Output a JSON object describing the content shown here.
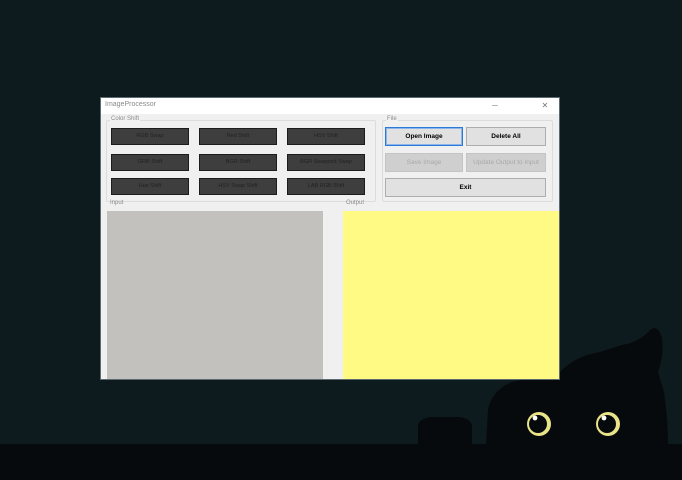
{
  "window": {
    "title": "ImageProcessor"
  },
  "controls": {
    "color_shift_label": "Color Shift",
    "buttons": [
      [
        "RGB Swap",
        "Red Shift",
        "HSV Shift"
      ],
      [
        "GRB Shift",
        "BGR Shift",
        "BGR Swapped Swap"
      ],
      [
        "Hue Shift",
        "HSV Swap Shift",
        "LAB RGB Shift"
      ]
    ]
  },
  "file": {
    "label": "File",
    "open_image": "Open Image",
    "delete_all": "Delete All",
    "save_image": "Save Image",
    "update": "Update Output to Input",
    "exit": "Exit"
  },
  "panes": {
    "input_label": "Input",
    "output_label": "Output",
    "input_color": "#c2c1bd",
    "output_color": "#fffa84"
  }
}
